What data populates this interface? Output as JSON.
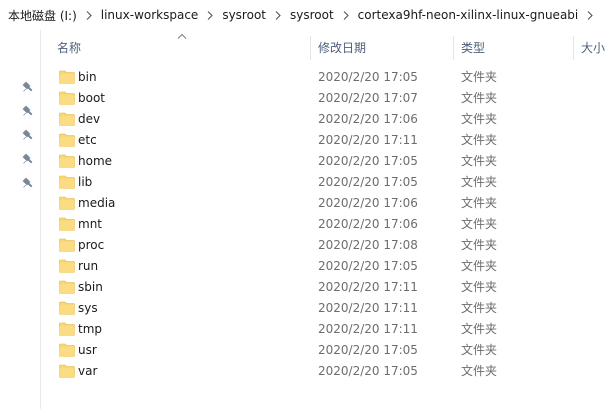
{
  "breadcrumb": [
    "本地磁盘 (I:)",
    "linux-workspace",
    "sysroot",
    "sysroot",
    "cortexa9hf-neon-xilinx-linux-gnueabi"
  ],
  "columns": {
    "name": "名称",
    "date": "修改日期",
    "type": "类型",
    "size": "大小"
  },
  "files": [
    {
      "name": "bin",
      "date": "2020/2/20 17:05",
      "type": "文件夹"
    },
    {
      "name": "boot",
      "date": "2020/2/20 17:07",
      "type": "文件夹"
    },
    {
      "name": "dev",
      "date": "2020/2/20 17:06",
      "type": "文件夹"
    },
    {
      "name": "etc",
      "date": "2020/2/20 17:11",
      "type": "文件夹"
    },
    {
      "name": "home",
      "date": "2020/2/20 17:05",
      "type": "文件夹"
    },
    {
      "name": "lib",
      "date": "2020/2/20 17:05",
      "type": "文件夹"
    },
    {
      "name": "media",
      "date": "2020/2/20 17:06",
      "type": "文件夹"
    },
    {
      "name": "mnt",
      "date": "2020/2/20 17:06",
      "type": "文件夹"
    },
    {
      "name": "proc",
      "date": "2020/2/20 17:08",
      "type": "文件夹"
    },
    {
      "name": "run",
      "date": "2020/2/20 17:05",
      "type": "文件夹"
    },
    {
      "name": "sbin",
      "date": "2020/2/20 17:11",
      "type": "文件夹"
    },
    {
      "name": "sys",
      "date": "2020/2/20 17:11",
      "type": "文件夹"
    },
    {
      "name": "tmp",
      "date": "2020/2/20 17:11",
      "type": "文件夹"
    },
    {
      "name": "usr",
      "date": "2020/2/20 17:05",
      "type": "文件夹"
    },
    {
      "name": "var",
      "date": "2020/2/20 17:05",
      "type": "文件夹"
    }
  ],
  "icons": {
    "breadcrumb_separator": "chevron-right-icon",
    "sort_indicator": "sort-ascending-icon",
    "pin": "pin-icon",
    "folder": "folder-icon"
  },
  "colors": {
    "folder": "#f8d775",
    "header_text": "#4c607a",
    "secondary_text": "#6d6d6d"
  }
}
